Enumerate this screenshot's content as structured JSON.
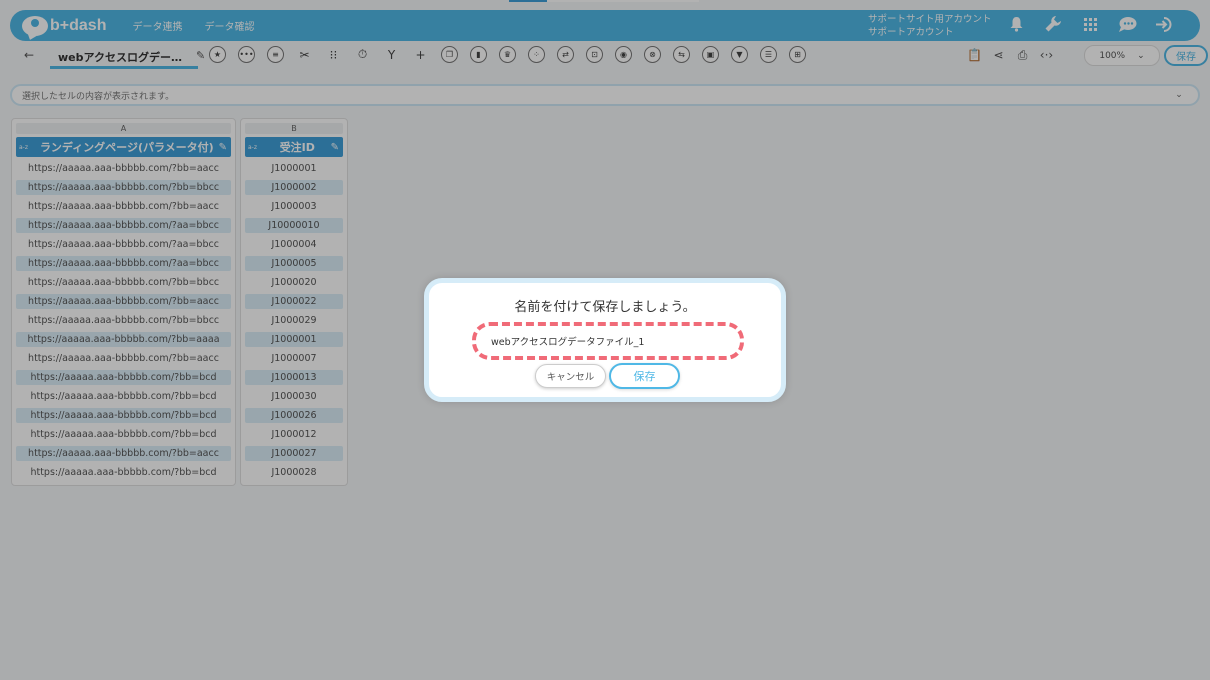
{
  "app": {
    "logo_text": "b+dash",
    "nav": [
      "データ連携",
      "データ確認"
    ],
    "account_line1": "サポートサイト用アカウント",
    "account_line2": "サポートアカウント"
  },
  "toolbar": {
    "file_title": "webアクセスログデー…",
    "zoom": "100%",
    "save_label": "保存"
  },
  "cellbar": {
    "placeholder": "選択したセルの内容が表示されます。"
  },
  "columns": [
    {
      "letter": "A",
      "type": "a-z",
      "header": "ランディングページ(パラメータ付)",
      "cells": [
        "https://aaaaa.aaa-bbbbb.com/?bb=aacc",
        "https://aaaaa.aaa-bbbbb.com/?bb=bbcc",
        "https://aaaaa.aaa-bbbbb.com/?bb=aacc",
        "https://aaaaa.aaa-bbbbb.com/?aa=bbcc",
        "https://aaaaa.aaa-bbbbb.com/?aa=bbcc",
        "https://aaaaa.aaa-bbbbb.com/?aa=bbcc",
        "https://aaaaa.aaa-bbbbb.com/?bb=bbcc",
        "https://aaaaa.aaa-bbbbb.com/?bb=aacc",
        "https://aaaaa.aaa-bbbbb.com/?bb=bbcc",
        "https://aaaaa.aaa-bbbbb.com/?bb=aaaa",
        "https://aaaaa.aaa-bbbbb.com/?bb=aacc",
        "https://aaaaa.aaa-bbbbb.com/?bb=bcd",
        "https://aaaaa.aaa-bbbbb.com/?bb=bcd",
        "https://aaaaa.aaa-bbbbb.com/?bb=bcd",
        "https://aaaaa.aaa-bbbbb.com/?bb=bcd",
        "https://aaaaa.aaa-bbbbb.com/?bb=aacc",
        "https://aaaaa.aaa-bbbbb.com/?bb=bcd"
      ]
    },
    {
      "letter": "B",
      "type": "a-z",
      "header": "受注ID",
      "cells": [
        "J1000001",
        "J1000002",
        "J1000003",
        "J10000010",
        "J1000004",
        "J1000005",
        "J1000020",
        "J1000022",
        "J1000029",
        "J1000001",
        "J1000007",
        "J1000013",
        "J1000030",
        "J1000026",
        "J1000012",
        "J1000027",
        "J1000028"
      ]
    }
  ],
  "modal": {
    "title": "名前を付けて保存しましょう。",
    "input_value": "webアクセスログデータファイル_1",
    "cancel_label": "キャンセル",
    "save_label": "保存"
  },
  "colors": {
    "brand": "#4fb8e6",
    "header": "#3f9fd8",
    "highlight": "#f06b78"
  }
}
